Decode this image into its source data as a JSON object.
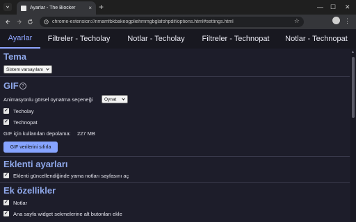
{
  "browser": {
    "tab_title": "Ayarlar - The Blocker",
    "tab_close": "×",
    "new_tab": "+",
    "url": "chrome-extension://nmamfbkbakeogpliehmmgbglafohpdif/options.html#settings.html",
    "window_controls": [
      "⌵",
      "—",
      "☐",
      "✕"
    ]
  },
  "tabs": [
    {
      "label": "Ayarlar",
      "active": true
    },
    {
      "label": "Filtreler - Techolay",
      "active": false
    },
    {
      "label": "Notlar - Techolay",
      "active": false
    },
    {
      "label": "Filtreler - Technopat",
      "active": false
    },
    {
      "label": "Notlar - Technopat",
      "active": false
    }
  ],
  "theme": {
    "title": "Tema",
    "select_value": "Sistem varsayılanı"
  },
  "gif": {
    "title": "GIF",
    "help": "?",
    "autoplay_label": "Animasyonlu görsel oynatma seçeneği",
    "autoplay_value": "Oynat",
    "techolay_label": "Techolay",
    "technopat_label": "Technopat",
    "storage_label": "GIF için kullanılan depolama:",
    "storage_value": "227 MB",
    "clear_button": "GIF verilerini sıfırla"
  },
  "extension_settings": {
    "title": "Eklenti ayarları",
    "patch_notes_label": "Eklenti güncellendiğinde yama notları sayfasını aç"
  },
  "extras": {
    "title": "Ek özellikler",
    "notes_label": "Notlar",
    "widget_label": "Ana sayfa widget sekmelerine alt butonları ekle"
  },
  "check_glyph": "✓",
  "colors": {
    "background": "#1d1d2a",
    "accent": "#8fa5ff",
    "section_title": "#8fa8ea",
    "button": "#87a4ff"
  }
}
